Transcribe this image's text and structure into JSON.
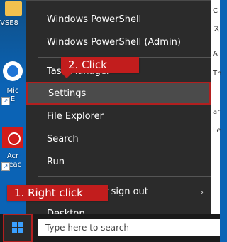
{
  "desktop": {
    "items": [
      {
        "label": "VSE8"
      },
      {
        "label": "Mic"
      },
      {
        "label": "E"
      },
      {
        "label": "Acr"
      },
      {
        "label": "Reac"
      }
    ],
    "right_fragments": [
      "C",
      "ス",
      "A",
      "Th",
      "ar",
      "Le"
    ]
  },
  "context_menu": {
    "items": [
      {
        "label": "Windows PowerShell"
      },
      {
        "label": "Windows PowerShell (Admin)"
      },
      {
        "label": "Task Manager"
      },
      {
        "label": "Settings"
      },
      {
        "label": "File Explorer"
      },
      {
        "label": "Search"
      },
      {
        "label": "Run"
      },
      {
        "label": "Shut down or sign out"
      },
      {
        "label": "Desktop"
      }
    ]
  },
  "callouts": {
    "click": "2. Click",
    "right_click": "1. Right click"
  },
  "taskbar": {
    "search_placeholder": "Type here to search"
  },
  "colors": {
    "accent_red": "#c21d1d",
    "menu_bg": "#2b2b2b",
    "desktop_blue": "#0b63b5"
  }
}
